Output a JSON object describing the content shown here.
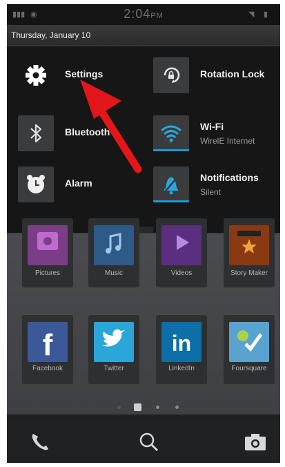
{
  "status_bar": {
    "time": "2:04",
    "time_suffix": "PM"
  },
  "date_bar": {
    "date": "Thursday, January 10"
  },
  "quick_settings": {
    "settings": {
      "label": "Settings",
      "icon": "gear-icon"
    },
    "rotation_lock": {
      "label": "Rotation Lock",
      "icon": "rotation-lock-icon"
    },
    "bluetooth": {
      "label": "Bluetooth",
      "icon": "bluetooth-icon"
    },
    "wifi": {
      "label": "Wi-Fi",
      "subtitle": "WirelE Internet",
      "icon": "wifi-icon",
      "state": "on"
    },
    "alarm": {
      "label": "Alarm",
      "icon": "alarm-clock-icon"
    },
    "notifications": {
      "label": "Notifications",
      "subtitle": "Silent",
      "icon": "bell-muted-icon",
      "state": "on"
    }
  },
  "home": {
    "row1": [
      {
        "label": "Pictures",
        "icon": "pictures-icon",
        "color": "#7a3e86"
      },
      {
        "label": "Music",
        "icon": "music-note-icon",
        "color": "#2d5a86"
      },
      {
        "label": "Videos",
        "icon": "video-play-icon",
        "color": "#5b2f80"
      },
      {
        "label": "Story Maker",
        "icon": "clapperboard-icon",
        "color": "#8a3a12"
      }
    ],
    "row2": [
      {
        "label": "Facebook",
        "icon": "facebook-icon",
        "color": "#3b5998",
        "glyph": "f"
      },
      {
        "label": "Twitter",
        "icon": "twitter-bird-icon",
        "color": "#2ba6d9",
        "glyph": ""
      },
      {
        "label": "LinkedIn",
        "icon": "linkedin-icon",
        "color": "#0e6ea8",
        "glyph": "in"
      },
      {
        "label": "Foursquare",
        "icon": "foursquare-icon",
        "color": "#5aa2cf",
        "glyph": ""
      }
    ]
  },
  "dock": {
    "phone": "phone-icon",
    "search": "search-icon",
    "camera": "camera-icon"
  },
  "colors": {
    "accent": "#1f9ad6",
    "arrow": "#e3161a"
  }
}
